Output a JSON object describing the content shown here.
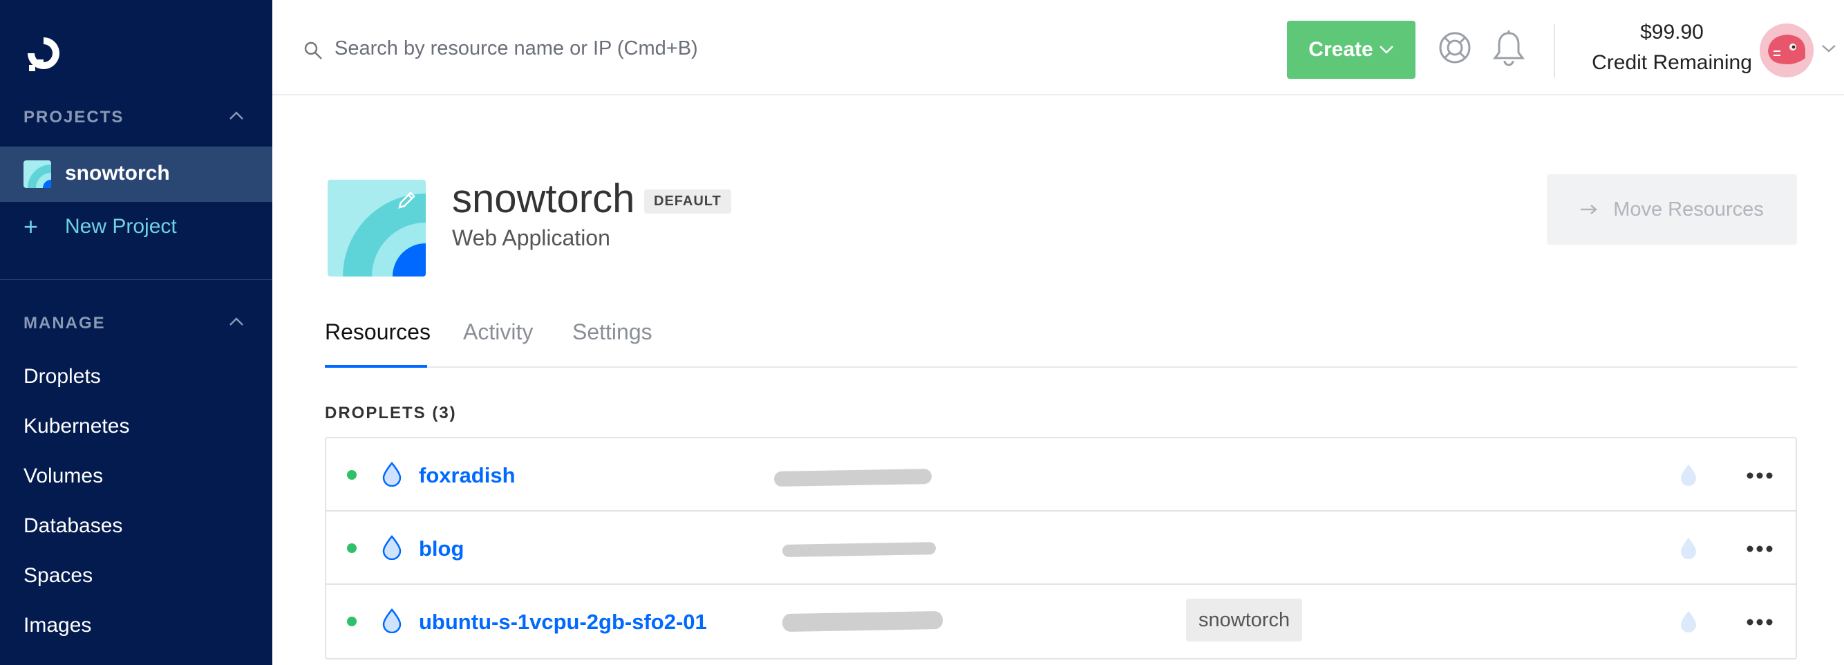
{
  "sidebar": {
    "projects_heading": "PROJECTS",
    "active_project": "snowtorch",
    "new_project_label": "New Project",
    "manage_heading": "MANAGE",
    "nav": [
      "Droplets",
      "Kubernetes",
      "Volumes",
      "Databases",
      "Spaces",
      "Images"
    ]
  },
  "topbar": {
    "search_placeholder": "Search by resource name or IP (Cmd+B)",
    "create_label": "Create",
    "credit_amount": "$99.90",
    "credit_label": "Credit Remaining"
  },
  "project": {
    "title": "snowtorch",
    "badge": "DEFAULT",
    "subtitle": "Web Application",
    "move_label": "Move Resources",
    "tabs": [
      "Resources",
      "Activity",
      "Settings"
    ]
  },
  "droplets": {
    "heading": "DROPLETS (3)",
    "rows": [
      {
        "name": "foxradish",
        "tag": ""
      },
      {
        "name": "blog",
        "tag": ""
      },
      {
        "name": "ubuntu-s-1vcpu-2gb-sfo2-01",
        "tag": "snowtorch"
      }
    ]
  },
  "colors": {
    "sidebar_bg": "#031b4e",
    "accent_blue": "#0069ff",
    "create_green": "#5fc878",
    "status_green": "#31c06a",
    "new_project_cyan": "#6fd3e6"
  },
  "icons": [
    "logo-icon",
    "chevron-up-icon",
    "plus-icon",
    "search-icon",
    "chevron-down-icon",
    "help-icon",
    "bell-icon",
    "pencil-icon",
    "arrow-right-icon",
    "droplet-icon",
    "ellipsis-icon"
  ]
}
